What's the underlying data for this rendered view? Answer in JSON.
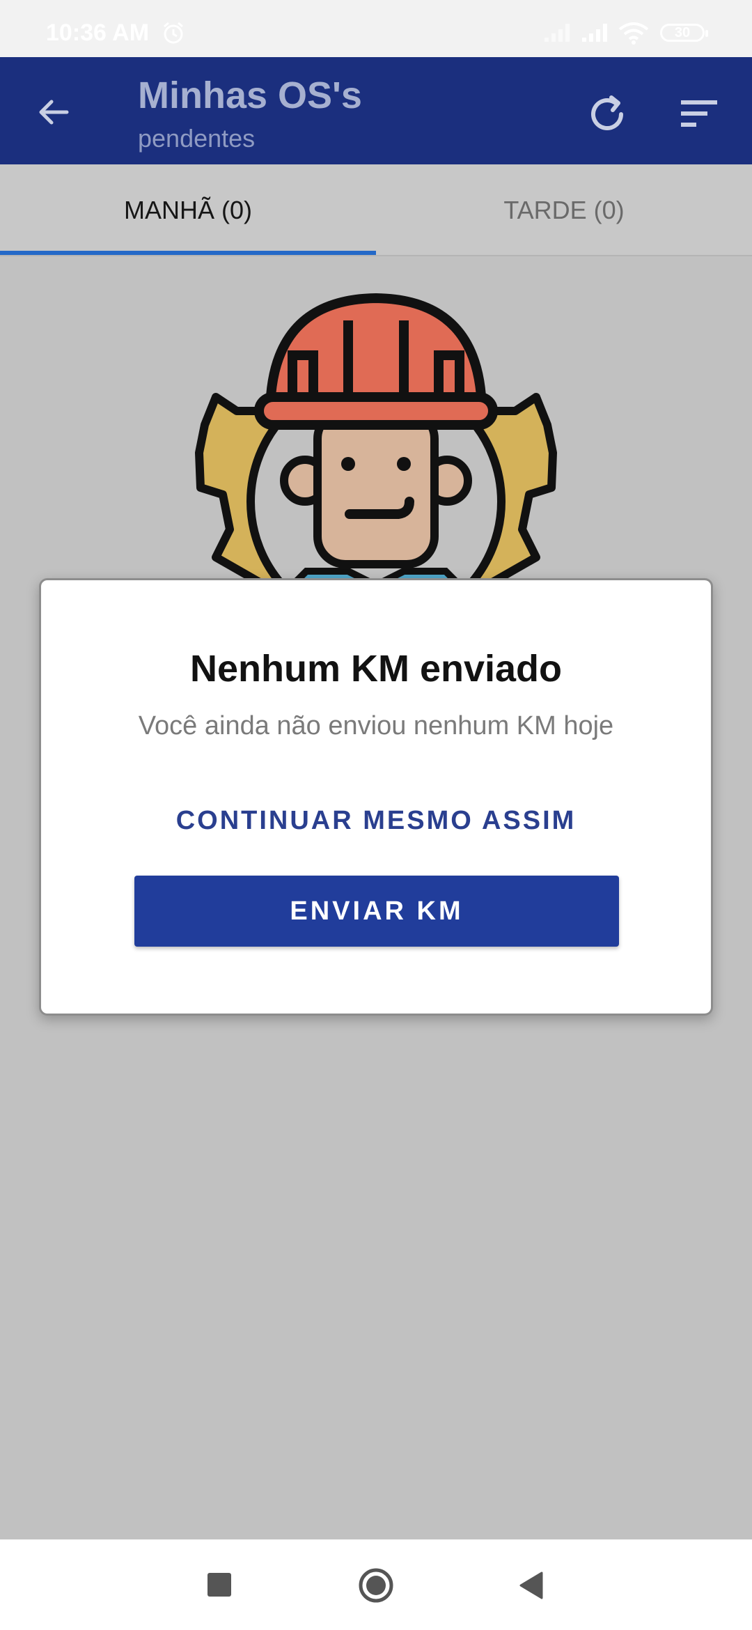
{
  "status_bar": {
    "time": "10:36 AM",
    "battery": "30",
    "icons": [
      "alarm-icon",
      "signal-icon",
      "signal-icon",
      "wifi-icon",
      "battery-icon"
    ]
  },
  "app_bar": {
    "title": "Minhas OS's",
    "subtitle": "pendentes",
    "background": "#1b2f7e",
    "icons": [
      "back-arrow-icon",
      "refresh-icon",
      "filter-sort-icon"
    ]
  },
  "tabs": [
    {
      "label": "MANHÃ (0)",
      "selected": true
    },
    {
      "label": "TARDE (0)",
      "selected": false
    }
  ],
  "tab_indicator_color": "#2469c8",
  "illustration": "worker-with-hard-hat-and-gear",
  "dialog": {
    "title": "Nenhum KM enviado",
    "message": "Você ainda não enviou nenhum KM hoje",
    "continue_label": "CONTINUAR MESMO ASSIM",
    "send_label": "ENVIAR KM",
    "primary_color": "#213d9b"
  },
  "nav_bar": {
    "icons": [
      "recent-apps-icon",
      "home-icon",
      "back-icon"
    ]
  }
}
